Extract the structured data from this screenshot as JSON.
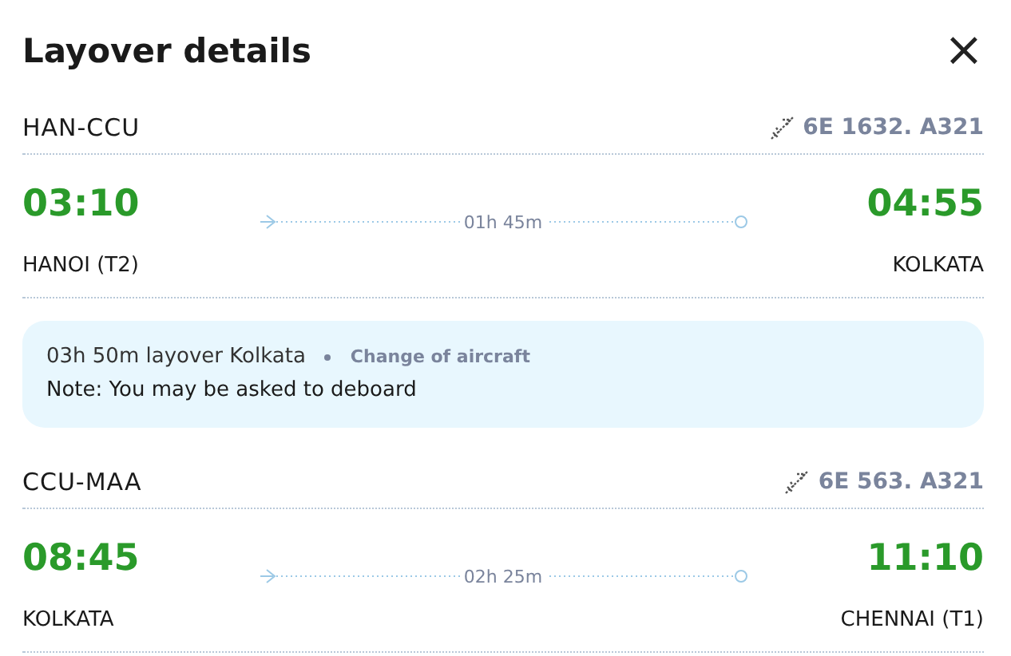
{
  "title": "Layover details",
  "close": "×",
  "segments": [
    {
      "route": "HAN-CCU",
      "flight": "6E 1632. A321",
      "depart_time": "03:10",
      "arrive_time": "04:55",
      "duration": "01h 45m",
      "from": "HANOI (T2)",
      "to": "KOLKATA"
    },
    {
      "route": "CCU-MAA",
      "flight": "6E 563. A321",
      "depart_time": "08:45",
      "arrive_time": "11:10",
      "duration": "02h 25m",
      "from": "KOLKATA",
      "to": "CHENNAI (T1)"
    }
  ],
  "layover": {
    "summary": "03h 50m layover Kolkata",
    "tag": "Change of aircraft",
    "note": "Note: You may be asked to deboard"
  }
}
